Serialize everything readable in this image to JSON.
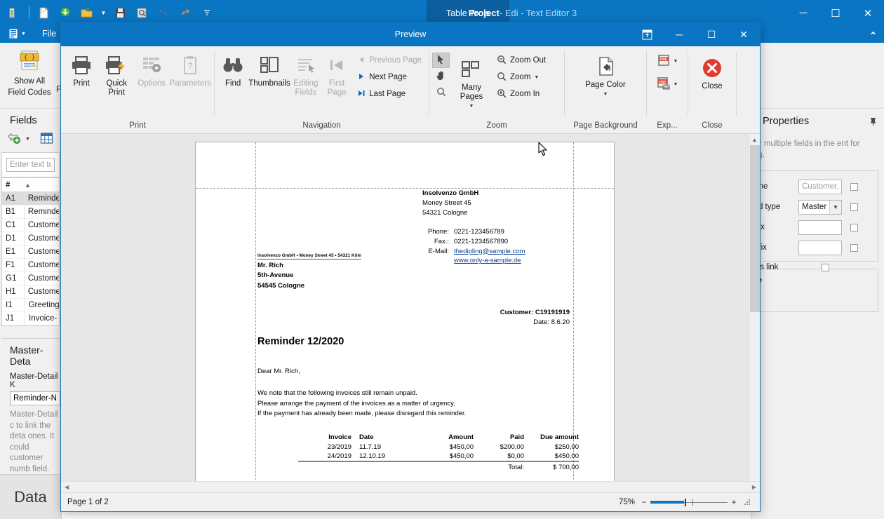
{
  "main_window": {
    "title_main": "Project",
    "title_sub": " - Edi - Text Editor 3",
    "contextual_tab": "Table Tools",
    "file_tab": "File",
    "quick_access_icons": [
      "pen-icon",
      "new-document-icon",
      "save-download-icon",
      "open-folder-icon",
      "folder-dropdown-icon",
      "save-icon",
      "print-preview-icon",
      "undo-icon",
      "redo-icon",
      "customize-qat-icon"
    ],
    "window_buttons": {
      "minimize": "─",
      "maximize": "☐",
      "close": "✕"
    },
    "ribbon_collapse": "⌃",
    "ribbon_button": {
      "label_line1": "Show All",
      "label_line2": "Field Codes",
      "icon": "field-codes-icon"
    },
    "ribbon_button_partial": "Fi"
  },
  "fields_panel": {
    "title": "Fields",
    "toolbar": {
      "add_field_icon": "add-field-icon",
      "dropdown_icon": "chevron-down-icon",
      "table_icon": "insert-table-icon"
    },
    "search_placeholder": "Enter text to",
    "columns": {
      "num": "#",
      "sort_indicator": "▲"
    },
    "rows": [
      {
        "id": "A1",
        "name": "Reminde"
      },
      {
        "id": "B1",
        "name": "Reminde"
      },
      {
        "id": "C1",
        "name": "Custome"
      },
      {
        "id": "D1",
        "name": "Custome"
      },
      {
        "id": "E1",
        "name": "Custome"
      },
      {
        "id": "F1",
        "name": "Custome"
      },
      {
        "id": "G1",
        "name": "Custome"
      },
      {
        "id": "H1",
        "name": "Custome"
      },
      {
        "id": "I1",
        "name": "Greeting"
      },
      {
        "id": "J1",
        "name": "Invoice-"
      }
    ],
    "master_detail": {
      "title": "Master-Deta",
      "key_label": "Master-Detail K",
      "key_value": "Reminder-Nr",
      "description": "Master-Detail c to link the deta ones. It could customer numb field."
    },
    "data_tab": "Data"
  },
  "properties_panel": {
    "title": "Properties",
    "pin_icon": "pin-icon",
    "hint": "one or multiple fields in the ent for editing.",
    "fields": [
      {
        "label": "ame",
        "type": "input",
        "placeholder": "Customer...",
        "value": ""
      },
      {
        "label": "eld type",
        "type": "select",
        "value": "Master"
      },
      {
        "label": "efix",
        "type": "input",
        "value": ""
      },
      {
        "label": "uffix",
        "type": "input",
        "value": ""
      }
    ],
    "is_link_label": "Is link",
    "second_box_title": "ne"
  },
  "preview_window": {
    "title": "Preview",
    "window_buttons": {
      "ribbon_display": "⛶",
      "minimize": "─",
      "maximize": "☐",
      "close": "✕"
    },
    "ribbon_groups": [
      {
        "label": "Print",
        "buttons": [
          {
            "name": "print",
            "label": "Print",
            "icon": "printer-icon",
            "enabled": true
          },
          {
            "name": "quick-print",
            "label": "Quick\nPrint",
            "icon": "quick-print-icon",
            "enabled": true
          },
          {
            "name": "options",
            "label": "Options",
            "icon": "options-gear-icon",
            "enabled": false
          },
          {
            "name": "parameters",
            "label": "Parameters",
            "icon": "parameters-clipboard-icon",
            "enabled": false
          }
        ]
      },
      {
        "label": "Navigation",
        "buttons": [
          {
            "name": "find",
            "label": "Find",
            "icon": "binoculars-icon",
            "enabled": true
          },
          {
            "name": "thumbnails",
            "label": "Thumbnails",
            "icon": "thumbnails-icon",
            "enabled": true
          },
          {
            "name": "editing-fields",
            "label": "Editing\nFields",
            "icon": "editing-fields-icon",
            "enabled": false
          },
          {
            "name": "first-page",
            "label": "First\nPage",
            "icon": "first-page-icon",
            "enabled": false
          },
          {
            "name": "previous-page",
            "label": "Previous Page",
            "icon": "triangle-left-icon",
            "enabled": false
          },
          {
            "name": "next-page",
            "label": "Next  Page",
            "icon": "triangle-right-icon",
            "enabled": true
          },
          {
            "name": "last-page",
            "label": "Last  Page",
            "icon": "last-page-icon",
            "enabled": true
          }
        ]
      },
      {
        "label": "Zoom",
        "buttons": [
          {
            "name": "pointer-tool",
            "label": "",
            "icon": "pointer-arrow-icon",
            "enabled": true,
            "active": true
          },
          {
            "name": "hand-tool",
            "label": "",
            "icon": "hand-icon",
            "enabled": true
          },
          {
            "name": "magnifier-tool",
            "label": "",
            "icon": "magnifier-icon",
            "enabled": true
          },
          {
            "name": "many-pages",
            "label": "Many Pages",
            "icon": "many-pages-icon",
            "enabled": true
          },
          {
            "name": "zoom-out",
            "label": "Zoom Out",
            "icon": "zoom-out-icon",
            "enabled": true
          },
          {
            "name": "zoom",
            "label": "Zoom",
            "icon": "zoom-icon",
            "enabled": true
          },
          {
            "name": "zoom-in",
            "label": "Zoom In",
            "icon": "zoom-in-icon",
            "enabled": true
          }
        ]
      },
      {
        "label": "Page Background",
        "buttons": [
          {
            "name": "page-color",
            "label": "Page Color",
            "icon": "page-color-icon",
            "enabled": true
          }
        ]
      },
      {
        "label": "Exp...",
        "buttons": [
          {
            "name": "export-pdf",
            "label": "",
            "icon": "export-pdf-icon",
            "enabled": true
          },
          {
            "name": "email-pdf",
            "label": "",
            "icon": "email-pdf-icon",
            "enabled": true
          }
        ]
      },
      {
        "label": "Close",
        "buttons": [
          {
            "name": "close-preview",
            "label": "Close",
            "icon": "close-circle-icon",
            "enabled": true
          }
        ]
      }
    ],
    "status": {
      "page_text": "Page 1 of 2",
      "zoom_level": "75%",
      "zoom_minus": "−",
      "zoom_plus": "+"
    }
  },
  "document": {
    "sender": {
      "company": "Insolvenzo GmbH",
      "street": "Money Street 45",
      "city": "54321 Cologne"
    },
    "contact": [
      {
        "label": "Phone:",
        "value": "0221-123456789",
        "link": false
      },
      {
        "label": "Fax.:",
        "value": "0221-1234567890",
        "link": false
      },
      {
        "label": "E-Mail:",
        "value": "thedipling@sample.com",
        "link": true
      },
      {
        "label": "",
        "value": "www.only-a-sample.de",
        "link": true
      }
    ],
    "return_address": "Insolvenzo GmbH • Money Street 45 • 54321 Köln",
    "recipient": {
      "name": "Mr. Rich",
      "street": "5th-Avenue",
      "city": "54545 Cologne"
    },
    "customer_line": "Customer: C19191919",
    "date_line": "Date: 8.6.20",
    "heading": "Reminder 12/2020",
    "salutation": "Dear Mr. Rich,",
    "body": [
      "We note that the following invoices still remain unpaid.",
      "Please arrange the payment of the invoices as a matter of urgency.",
      "If the payment has already been made, please disregard this reminder."
    ],
    "invoice_table": {
      "headers": [
        "Invoice",
        "Date",
        "Amount",
        "Paid",
        "Due amount"
      ],
      "rows": [
        [
          "23/2019",
          "11.7.19",
          "$450,00",
          "$200,00",
          "$250,00"
        ],
        [
          "24/2019",
          "12.10.19",
          "$450,00",
          "$0,00",
          "$450,00"
        ]
      ],
      "total_label": "Total:",
      "total_value": "$ 700,00"
    }
  },
  "colors": {
    "titlebar_blue": "#0a75c2",
    "contextual_tab_blue": "#0b5f9e",
    "link_blue": "#0b3d91",
    "close_red": "#e03c31",
    "ribbon_bg": "#f0f0f0"
  }
}
